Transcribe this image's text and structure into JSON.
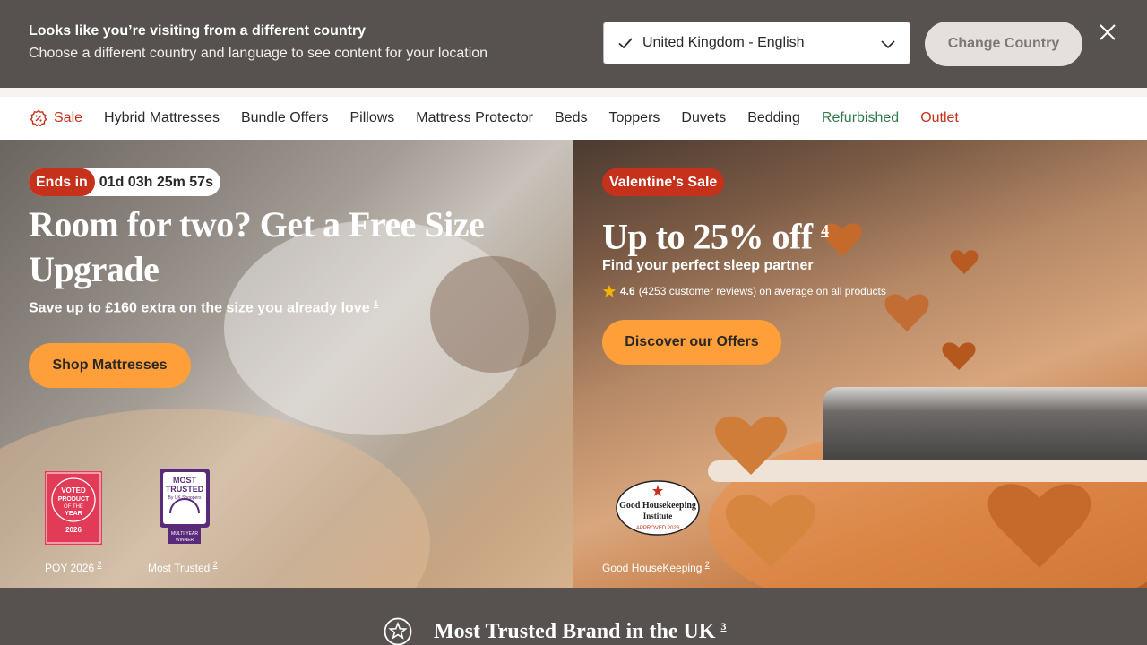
{
  "country_banner": {
    "title": "Looks like you’re visiting from a different country",
    "subtitle": "Choose a different country and language to see content for your location",
    "selected_country": "United Kingdom - English",
    "button_label": "Change Country"
  },
  "nav": {
    "items": [
      {
        "label": "Sale"
      },
      {
        "label": "Hybrid Mattresses"
      },
      {
        "label": "Bundle Offers"
      },
      {
        "label": "Pillows"
      },
      {
        "label": "Mattress Protector"
      },
      {
        "label": "Beds"
      },
      {
        "label": "Toppers"
      },
      {
        "label": "Duvets"
      },
      {
        "label": "Bedding"
      },
      {
        "label": "Refurbished"
      },
      {
        "label": "Outlet"
      }
    ]
  },
  "hero_left": {
    "countdown_label": "Ends in",
    "countdown_time": "01d 03h 25m 57s",
    "title": "Room for two? Get a Free Size Upgrade",
    "subtitle": "Save up to £160 extra on the size you already love",
    "subtitle_sup": "1",
    "cta": "Shop Mattresses",
    "badges": [
      {
        "caption": "POY 2026",
        "sup": "2",
        "badge_text": [
          "VOTED",
          "PRODUCT",
          "OF THE",
          "YEAR",
          "2026"
        ]
      },
      {
        "caption": "Most Trusted",
        "sup": "2",
        "badge_text": [
          "MOST",
          "TRUSTED",
          "By UK Shoppers",
          "MULTI-YEAR",
          "WINNER"
        ]
      }
    ]
  },
  "hero_right": {
    "tag": "Valentine's Sale",
    "title": "Up to 25% off",
    "title_sup": "4",
    "subtitle": "Find your perfect sleep partner",
    "rating_value": "4.6",
    "rating_text": "(4253 customer reviews) on average on all products",
    "cta": "Discover our Offers",
    "badge": {
      "caption": "Good HouseKeeping",
      "sup": "2",
      "badge_text": [
        "Good Housekeeping",
        "Institute",
        "APPROVED 2026"
      ]
    }
  },
  "trusted": {
    "title": "Most Trusted Brand in the UK",
    "sup": "3"
  },
  "colors": {
    "banner_bg": "#575250",
    "accent_orange": "#ff9f3a",
    "sale_red": "#c6311b",
    "refurb_green": "#2f7a4f"
  },
  "icons": [
    "check-icon",
    "chevron-down-icon",
    "close-icon",
    "sale-badge-icon",
    "star-icon",
    "star-circle-icon"
  ]
}
